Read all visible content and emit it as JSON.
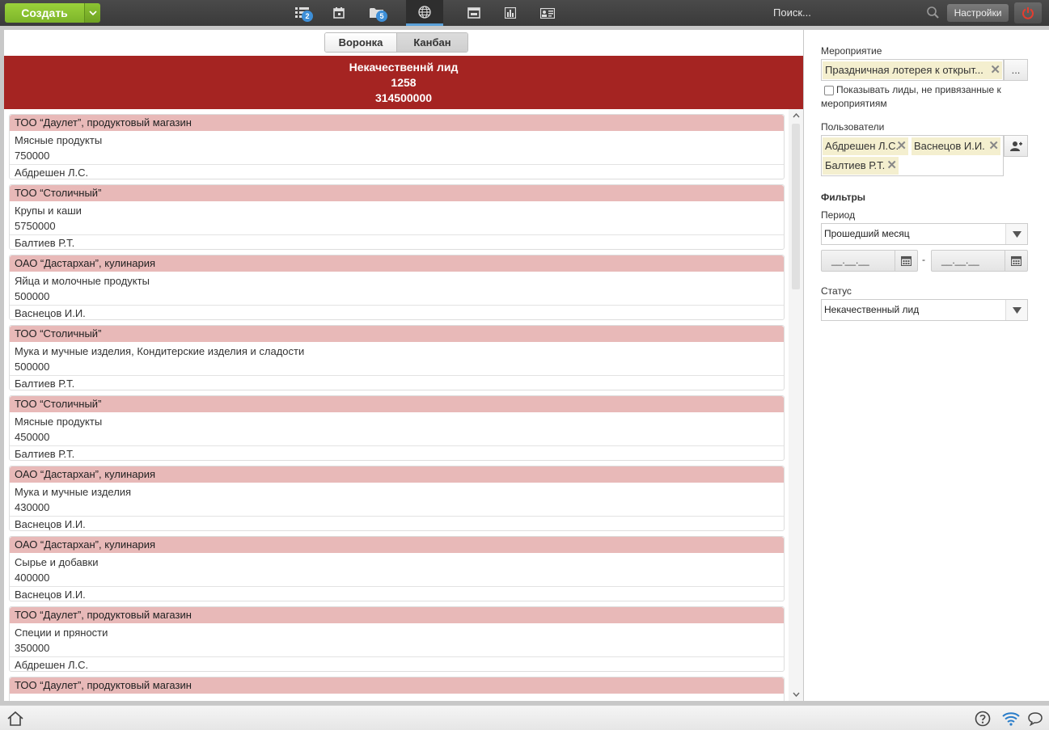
{
  "topbar": {
    "create_label": "Создать",
    "icons": [
      {
        "name": "tasks-icon",
        "badge": "2"
      },
      {
        "name": "calendar-icon",
        "badge": ""
      },
      {
        "name": "folder-icon",
        "badge": "5"
      },
      {
        "name": "globe-icon",
        "badge": ""
      },
      {
        "name": "browser-window-icon",
        "badge": ""
      },
      {
        "name": "bar-chart-icon",
        "badge": ""
      },
      {
        "name": "contact-card-icon",
        "badge": ""
      }
    ],
    "search_placeholder": "Поиск...",
    "settings_label": "Настройки"
  },
  "main": {
    "tabs": [
      {
        "label": "Воронка",
        "active": false
      },
      {
        "label": "Канбан",
        "active": true
      }
    ],
    "stage": {
      "title": "Некачественнй лид",
      "count": "1258",
      "sum": "314500000",
      "color": "#a52422"
    },
    "cards": [
      {
        "company": "ТОО “Даулет”, продуктовый магазин",
        "product": "Мясные продукты",
        "amount": "750000",
        "user": "Абдрешен Л.С."
      },
      {
        "company": "ТОО “Столичный”",
        "product": "Крупы и каши",
        "amount": "5750000",
        "user": "Балтиев Р.Т."
      },
      {
        "company": "ОАО “Дастархан”, кулинария",
        "product": "Яйца и молочные продукты",
        "amount": "500000",
        "user": "Васнецов И.И."
      },
      {
        "company": "ТОО “Столичный”",
        "product": "Мука и мучные изделия, Кондитерские изделия и сладости",
        "amount": "500000",
        "user": "Балтиев Р.Т."
      },
      {
        "company": "ТОО “Столичный”",
        "product": "Мясные продукты",
        "amount": "450000",
        "user": "Балтиев Р.Т."
      },
      {
        "company": "ОАО “Дастархан”, кулинария",
        "product": "Мука и мучные изделия",
        "amount": "430000",
        "user": "Васнецов И.И."
      },
      {
        "company": "ОАО “Дастархан”, кулинария",
        "product": "Сырье и добавки",
        "amount": "400000",
        "user": "Васнецов И.И."
      },
      {
        "company": "ТОО “Даулет”, продуктовый магазин",
        "product": "Специи и пряности",
        "amount": "350000",
        "user": "Абдрешен Л.С."
      },
      {
        "company": "ТОО “Даулет”, продуктовый магазин",
        "product": "",
        "amount": "",
        "user": ""
      }
    ]
  },
  "filters": {
    "event_label": "Мероприятие",
    "event_value": "Праздничная лотерея к открыт...",
    "more_button": "...",
    "show_unlinked_label": "Показывать лиды, не привязанные к мероприятиям",
    "users_label": "Пользователи",
    "users": [
      "Абдрешен Л.С.",
      "Васнецов И.И.",
      "Балтиев Р.Т."
    ],
    "heading": "Фильтры",
    "period_label": "Период",
    "period_value": "Прошедший месяц",
    "date_from": "__.__.__",
    "date_separator": "-",
    "date_to": "__.__.__",
    "status_label": "Статус",
    "status_value": "Некачественный лид"
  }
}
